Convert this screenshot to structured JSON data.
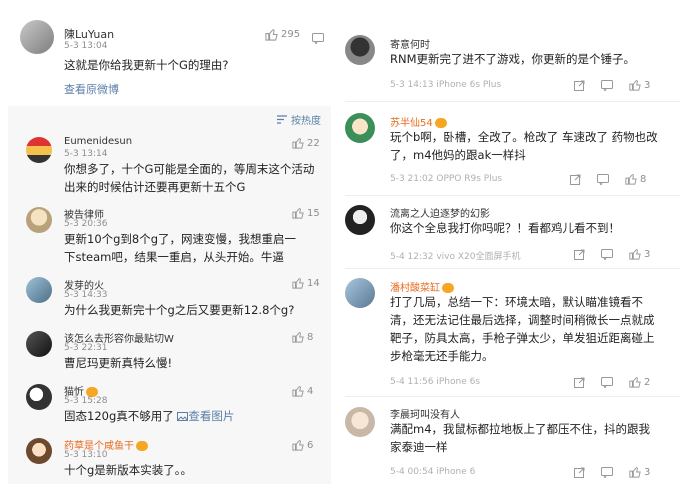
{
  "left_top": {
    "user": "陳LuYuan",
    "time": "5-3 13:04",
    "text": "这就是你给我更新十个G的理由?",
    "link": "查看原微博",
    "likes": "295"
  },
  "sort_label": "按热度",
  "left_comments": [
    {
      "user": "Eumenidesun",
      "time": "5-3 13:14",
      "text": "你想多了，十个G可能是全面的，等周末这个活动出来的时候估计还要再更新十五个G",
      "likes": "22"
    },
    {
      "user": "被告律师",
      "time": "5-3 20:36",
      "text": "更新10个g到8个g了，网速变慢，我想重启一下steam吧，结果一重启，从头开始。牛逼",
      "likes": "15"
    },
    {
      "user": "发芽的火",
      "time": "5-3 14:33",
      "text": "为什么我更新完十个g之后又要更新12.8个g?",
      "likes": "14"
    },
    {
      "user": "该怎么去形容你最贴切W",
      "time": "5-3 22:31",
      "text": "曹尼玛更新真特么慢!",
      "likes": "8"
    },
    {
      "user": "猫忻",
      "time": "5-3 15:28",
      "text": "固态120g真不够用了",
      "link": "查看图片",
      "likes": "4"
    },
    {
      "user": "药草是个咸鱼干",
      "time": "5-3 13:10",
      "text": "十个g是新版本实装了。。",
      "likes": "6"
    }
  ],
  "right_comments": [
    {
      "user": "寄意何时",
      "text": "RNM更新完了进不了游戏，你更新的是个锤子。",
      "meta": "5-3 14:13 iPhone 6s Plus",
      "likes": "3"
    },
    {
      "user": "苏半仙54",
      "text": "玩个b啊，卧槽，全改了。枪改了 车速改了 药物也改了，m4他妈的跟ak一样抖",
      "meta": "5-3 21:02 OPPO R9s Plus",
      "likes": "8"
    },
    {
      "user": "流离之人迫逐梦的幻影",
      "text": "你这个全息我打你吗呢？！看都鸡儿看不到！",
      "meta": "5-4 12:32 vivo X20全面屏手机",
      "likes": "3"
    },
    {
      "user": "潘村酸菜缸",
      "text": "打了几局，总结一下：环境太暗，默认瞄准镜看不清，还无法记住最后选择，调整时间稍微长一点就成靶子，防具太高，手枪子弹太少，单发狙近距离碰上步枪毫无还手能力。",
      "meta": "5-4 11:56 iPhone 6s",
      "likes": "2"
    },
    {
      "user": "李晨珂叫没有人",
      "text": "满配m4，我鼠标都拉地板上了都压不住，抖的跟我家泰迪一样",
      "meta": "5-4 00:54 iPhone 6",
      "likes": "3"
    }
  ]
}
